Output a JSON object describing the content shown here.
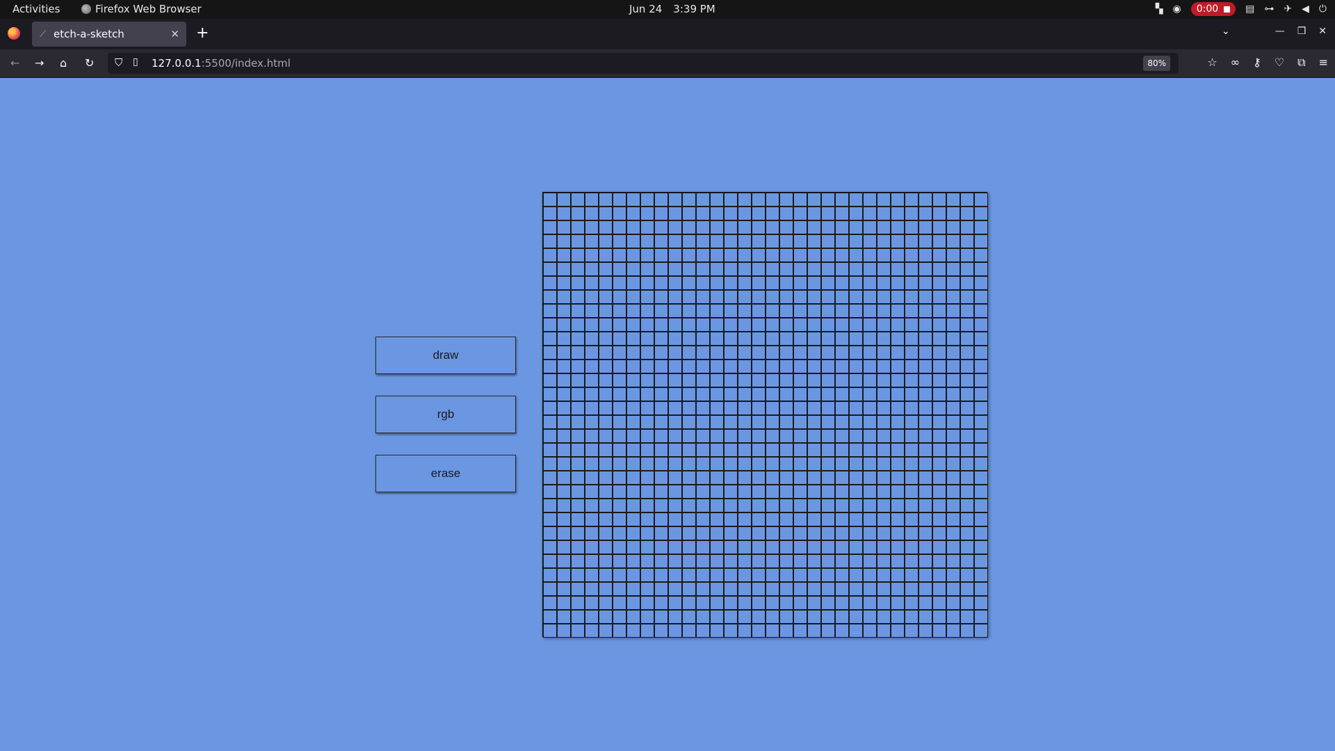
{
  "system_bar": {
    "activities": "Activities",
    "app_name": "Firefox Web Browser",
    "date": "Jun 24",
    "time": "3:39 PM",
    "recording_time": "0:00"
  },
  "browser": {
    "tab_title": "etch-a-sketch",
    "url_host": "127.0.0.1",
    "url_rest": ":5500/index.html",
    "zoom": "80%"
  },
  "page": {
    "background_color": "#6b97e2",
    "buttons": [
      {
        "label": "draw"
      },
      {
        "label": "rgb"
      },
      {
        "label": "erase"
      }
    ],
    "grid": {
      "rows": 32,
      "columns": 32
    }
  }
}
